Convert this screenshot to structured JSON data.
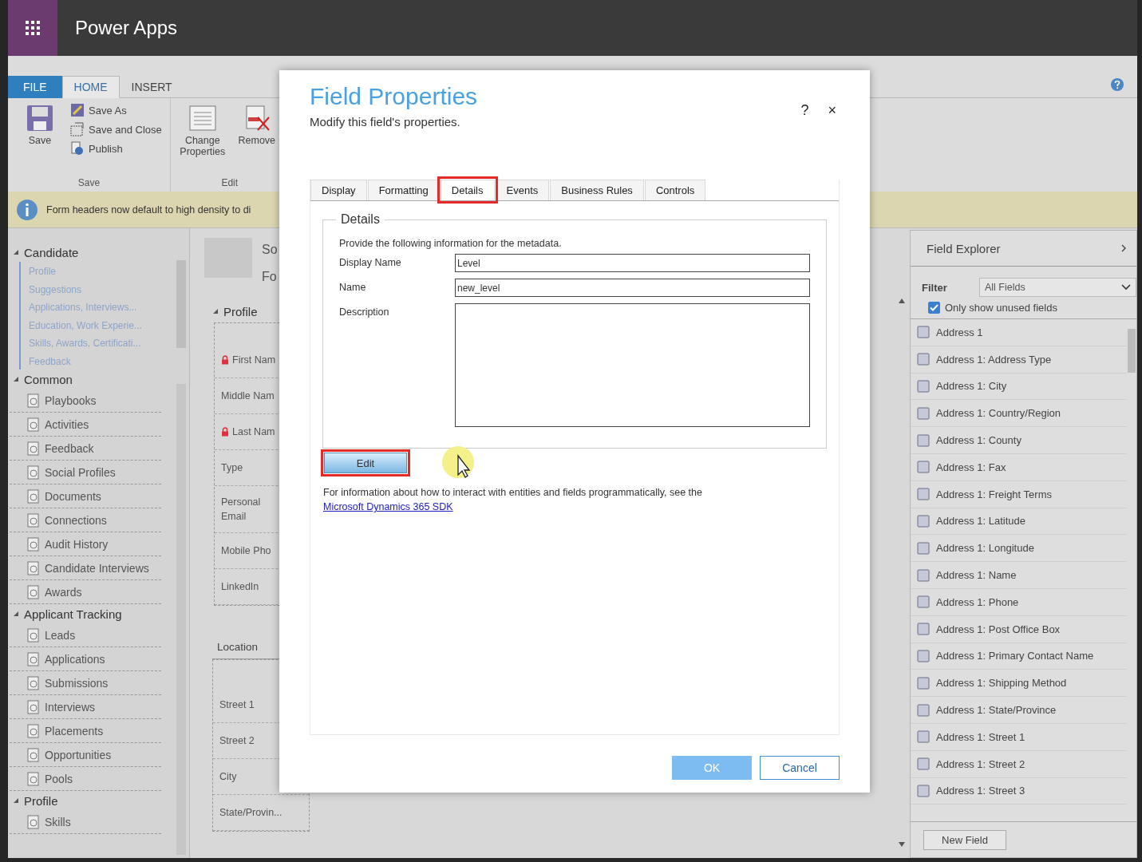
{
  "app": {
    "title": "Power Apps"
  },
  "ribbon": {
    "tabs": [
      {
        "label": "FILE",
        "kind": "file",
        "selected": false
      },
      {
        "label": "HOME",
        "kind": "tab",
        "selected": true
      },
      {
        "label": "INSERT",
        "kind": "tab",
        "selected": false
      }
    ],
    "save_group": {
      "label": "Save",
      "large_button": "Save",
      "buttons": [
        "Save As",
        "Save and Close",
        "Publish"
      ]
    },
    "edit_group": {
      "label": "Edit",
      "buttons": [
        "Change Properties",
        "Remove"
      ]
    }
  },
  "info_bar": {
    "text": "Form headers now default to high density to di"
  },
  "navigation": {
    "sections": [
      {
        "title": "Candidate",
        "expanded": true,
        "kind": "links",
        "items": [
          "Profile",
          "Suggestions",
          "Applications, Interviews...",
          "Education, Work Experie...",
          "Skills, Awards, Certificati...",
          "Feedback"
        ]
      },
      {
        "title": "Common",
        "expanded": true,
        "kind": "entities",
        "items": [
          "Playbooks",
          "Activities",
          "Feedback",
          "Social Profiles",
          "Documents",
          "Connections",
          "Audit History",
          "Candidate Interviews",
          "Awards"
        ]
      },
      {
        "title": "Applicant Tracking",
        "expanded": true,
        "kind": "entities",
        "items": [
          "Leads",
          "Applications",
          "Submissions",
          "Interviews",
          "Placements",
          "Opportunities",
          "Pools"
        ]
      },
      {
        "title": "Profile",
        "expanded": true,
        "kind": "entities",
        "items": [
          "Skills"
        ]
      }
    ]
  },
  "form": {
    "header": [
      "So",
      "Fo"
    ],
    "sections": [
      {
        "title": "Profile",
        "kind": "tab",
        "fields": [
          {
            "label": "First Nam",
            "required": true
          },
          {
            "label": "Middle Nam",
            "required": false
          },
          {
            "label": "Last Nam",
            "required": true
          },
          {
            "label": "Type",
            "required": false
          },
          {
            "label": "Personal Email",
            "required": false
          },
          {
            "label": "Mobile Pho",
            "required": false
          },
          {
            "label": "LinkedIn",
            "required": false
          }
        ]
      },
      {
        "title": "Location",
        "kind": "section",
        "fields": [
          {
            "label": "Street 1",
            "required": false
          },
          {
            "label": "Street 2",
            "required": false
          },
          {
            "label": "City",
            "required": false
          },
          {
            "label": "State/Provin...",
            "required": false
          }
        ]
      }
    ]
  },
  "dialog": {
    "title": "Field Properties",
    "subtitle": "Modify this field's properties.",
    "help": "?",
    "close": "×",
    "tabs": [
      {
        "label": "Display",
        "selected": false
      },
      {
        "label": "Formatting",
        "selected": false
      },
      {
        "label": "Details",
        "selected": true
      },
      {
        "label": "Events",
        "selected": false
      },
      {
        "label": "Business Rules",
        "selected": false
      },
      {
        "label": "Controls",
        "selected": false
      }
    ],
    "fieldset": {
      "legend": "Details",
      "intro": "Provide the following information for the metadata.",
      "fields": [
        {
          "label": "Display Name",
          "kind": "text",
          "value": "Level"
        },
        {
          "label": "Name",
          "kind": "text",
          "value": "new_level"
        },
        {
          "label": "Description",
          "kind": "textarea"
        }
      ]
    },
    "edit_button": {
      "label": "Edit",
      "highlighted": true
    },
    "note": {
      "text": "For information about how to interact with entities and fields programmatically, see the",
      "link": "Microsoft Dynamics 365 SDK"
    },
    "buttons": [
      {
        "label": "OK",
        "kind": "primary"
      },
      {
        "label": "Cancel",
        "kind": "secondary"
      }
    ]
  },
  "field_explorer": {
    "title": "Field Explorer",
    "filter_label": "Filter",
    "filter_value": "All Fields",
    "only_unused": {
      "label": "Only show unused fields",
      "checked": true
    },
    "fields": [
      "Address 1",
      "Address 1: Address Type",
      "Address 1: City",
      "Address 1: Country/Region",
      "Address 1: County",
      "Address 1: Fax",
      "Address 1: Freight Terms",
      "Address 1: Latitude",
      "Address 1: Longitude",
      "Address 1: Name",
      "Address 1: Phone",
      "Address 1: Post Office Box",
      "Address 1: Primary Contact Name",
      "Address 1: Shipping Method",
      "Address 1: State/Province",
      "Address 1: Street 1",
      "Address 1: Street 2",
      "Address 1: Street 3"
    ],
    "new_field": "New Field"
  }
}
